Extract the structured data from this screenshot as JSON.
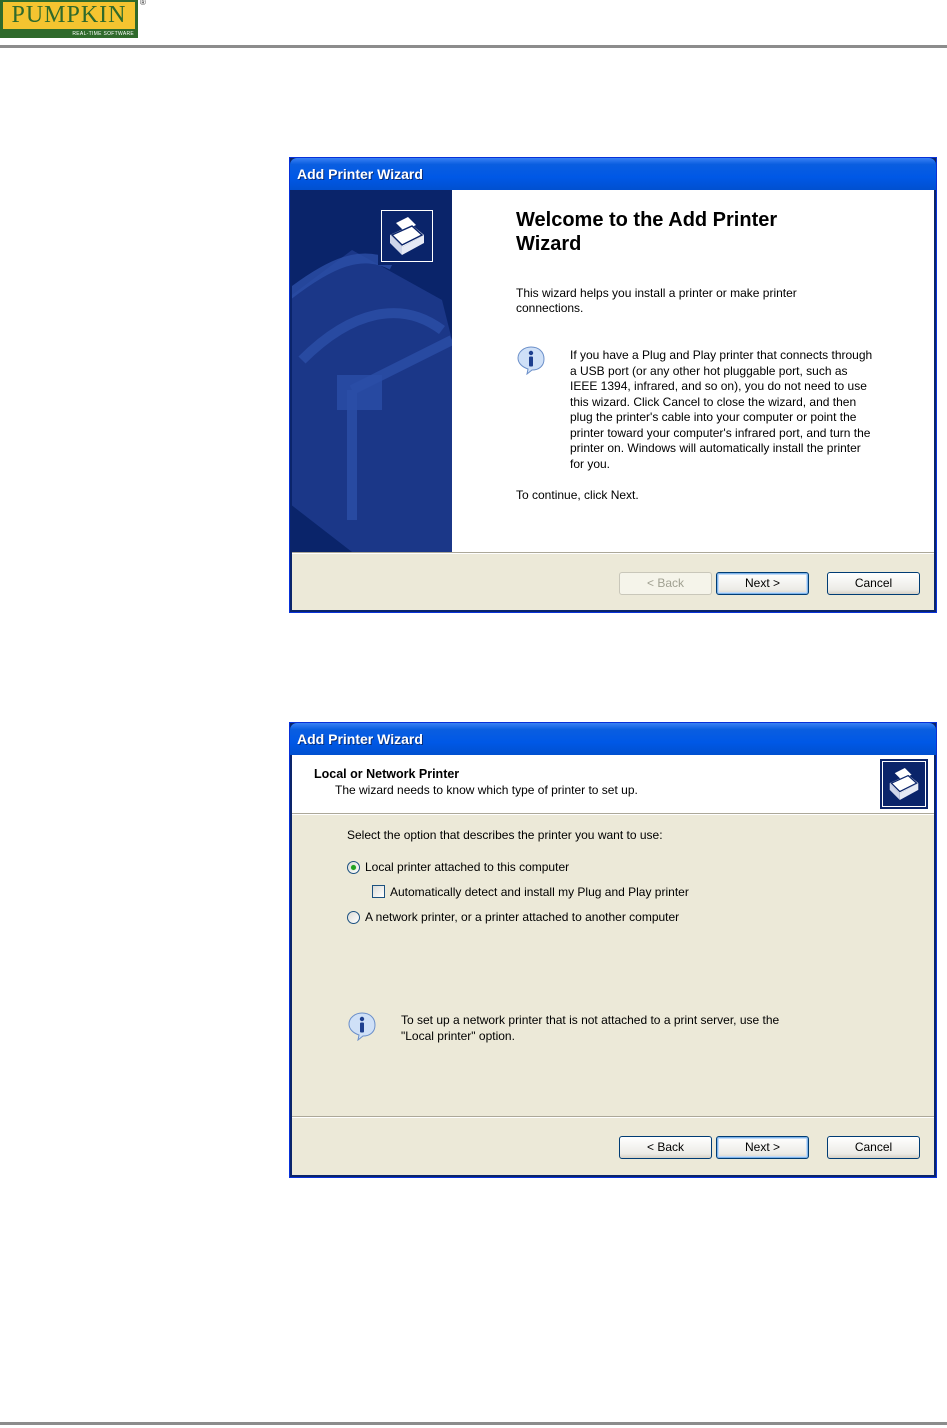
{
  "logo": {
    "word": "PUMPKIN",
    "tagline": "REAL-TIME SOFTWARE",
    "trademark": "®"
  },
  "icons": {
    "info": "info-icon",
    "printer": "printer-icon"
  },
  "colors": {
    "xp_title": "#0058e6",
    "wizard_side": "#0a246a",
    "face": "#ece9d8",
    "radio_dot": "#21a121"
  },
  "wizard1": {
    "title": "Add Printer Wizard",
    "heading": "Welcome to the Add Printer Wizard",
    "intro": "This wizard helps you install a printer or make printer connections.",
    "note": "If you have a Plug and Play printer that connects through a USB port (or any other hot pluggable port, such as IEEE 1394, infrared, and so on), you do not need to use this wizard. Click Cancel to close the wizard, and then plug the printer's cable into your computer or point the printer toward your computer's infrared port, and turn the printer on. Windows will automatically install the printer for you.",
    "continue": "To continue, click Next.",
    "buttons": {
      "back": "< Back",
      "next": "Next >",
      "cancel": "Cancel"
    }
  },
  "wizard2": {
    "title": "Add Printer Wizard",
    "header_title": "Local or Network Printer",
    "header_subtitle": "The wizard needs to know which type of printer to set up.",
    "prompt": "Select the option that describes the printer you want to use:",
    "options": {
      "local": {
        "label": "Local printer attached to this computer",
        "selected": true
      },
      "autodetect": {
        "label": "Automatically detect and install my Plug and Play printer",
        "checked": false
      },
      "network": {
        "label": "A network printer, or a printer attached to another computer",
        "selected": false
      }
    },
    "note": "To set up a network printer that is not attached to a print server, use the \"Local printer\" option.",
    "buttons": {
      "back": "< Back",
      "next": "Next >",
      "cancel": "Cancel"
    }
  }
}
